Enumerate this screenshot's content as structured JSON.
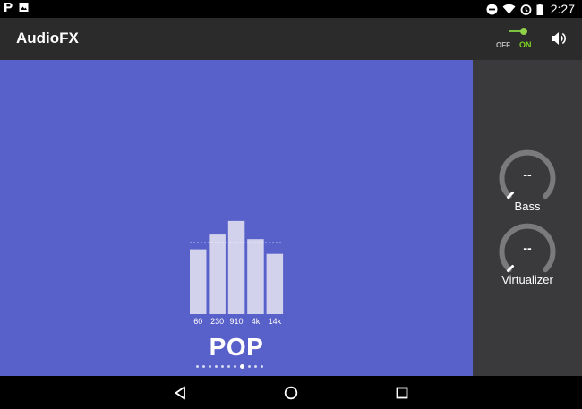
{
  "status_bar": {
    "time": "2:27",
    "icons": [
      "p-notification-icon",
      "image-notification-icon",
      "do-not-disturb-icon",
      "wifi-icon",
      "alarm-icon",
      "battery-icon"
    ]
  },
  "toolbar": {
    "title": "AudioFX",
    "toggle_off_label": "OFF",
    "toggle_on_label": "ON",
    "toggle_state": "on",
    "speaker_icon": "speaker-icon"
  },
  "equalizer": {
    "preset": "POP",
    "bands": [
      {
        "label": "60",
        "level": 0.57
      },
      {
        "label": "230",
        "level": 0.7
      },
      {
        "label": "910",
        "level": 0.82
      },
      {
        "label": "4k",
        "level": 0.66
      },
      {
        "label": "14k",
        "level": 0.53
      }
    ],
    "reference_level": 0.63,
    "preset_page": 8,
    "preset_count": 11
  },
  "effects": [
    {
      "label": "Bass",
      "value": "--"
    },
    {
      "label": "Virtualizer",
      "value": "--"
    }
  ],
  "nav_bar": {
    "icons": [
      "back-icon",
      "home-icon",
      "recents-icon"
    ]
  },
  "colors": {
    "eq_background": "#5860c9",
    "bar_fill": "#dcdcf0",
    "toolbar": "#2b2b2b",
    "side_panel": "#3a3a3c",
    "toggle_on": "#7ed321"
  }
}
